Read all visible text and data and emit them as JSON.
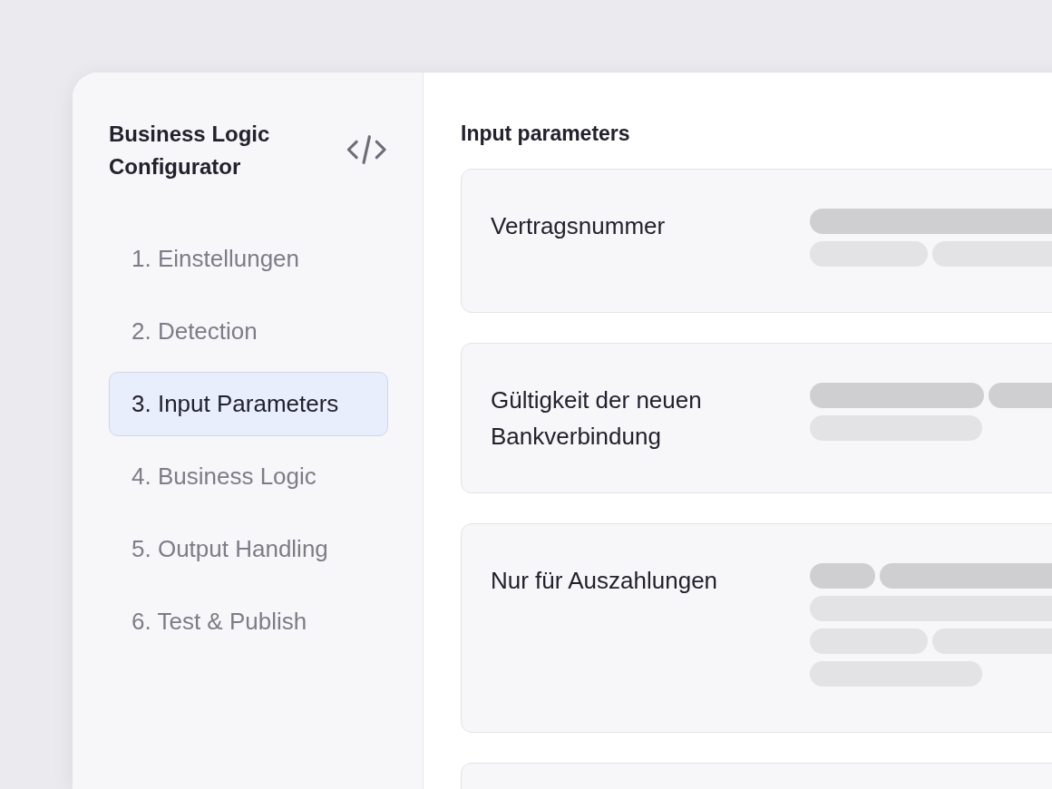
{
  "sidebar": {
    "title": "Business Logic Configurator",
    "steps": [
      {
        "label": "1. Einstellungen",
        "selected": false
      },
      {
        "label": "2. Detection",
        "selected": false
      },
      {
        "label": "3. Input Parameters",
        "selected": true
      },
      {
        "label": "4. Business Logic",
        "selected": false
      },
      {
        "label": "5. Output Handling",
        "selected": false
      },
      {
        "label": "6. Test & Publish",
        "selected": false
      }
    ]
  },
  "main": {
    "heading": "Input parameters",
    "cards": [
      {
        "kind": "field",
        "label": "Vertragsnummer"
      },
      {
        "kind": "field",
        "label": "Gültigkeit der neuen Bankverbindung"
      },
      {
        "kind": "field",
        "label": "Nur für Auszahlungen"
      },
      {
        "kind": "empty"
      }
    ]
  }
}
